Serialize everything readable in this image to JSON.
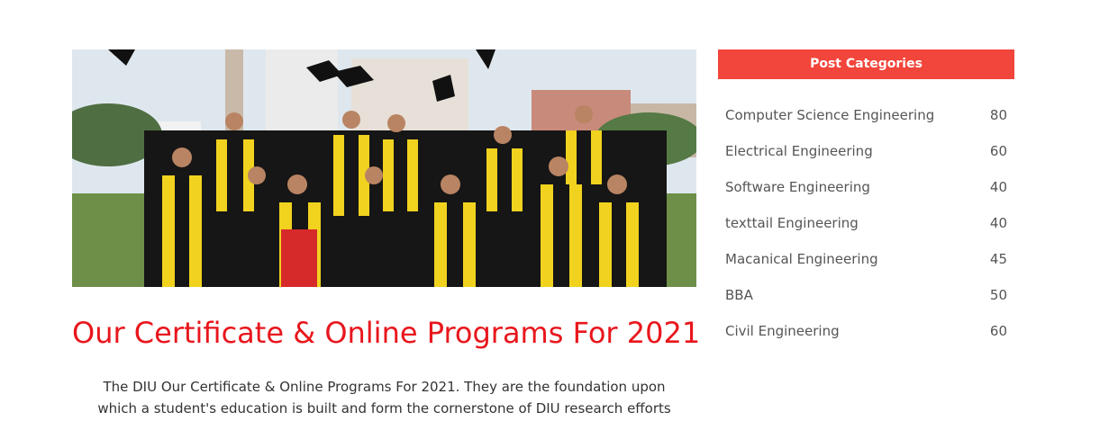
{
  "hero": {
    "image_alt": "Graduates in black and yellow gowns throwing caps"
  },
  "post": {
    "title": "Our Certificate & Online Programs For 2021",
    "body": "The DIU Our Certificate & Online Programs For 2021. They are the foundation upon which a student's education is built and form the cornerstone of DIU research efforts"
  },
  "sidebar": {
    "heading": "Post Categories",
    "categories": [
      {
        "name": "Computer Science Engineering",
        "count": "80"
      },
      {
        "name": "Electrical Engineering",
        "count": "60"
      },
      {
        "name": "Software Engineering",
        "count": "40"
      },
      {
        "name": "texttail Engineering",
        "count": "40"
      },
      {
        "name": "Macanical Engineering",
        "count": "45"
      },
      {
        "name": "BBA",
        "count": "50"
      },
      {
        "name": "Civil Engineering",
        "count": "60"
      }
    ]
  },
  "colors": {
    "accent": "#f2453b",
    "title": "#e8161c",
    "text": "#333333",
    "category_text": "#555555"
  }
}
